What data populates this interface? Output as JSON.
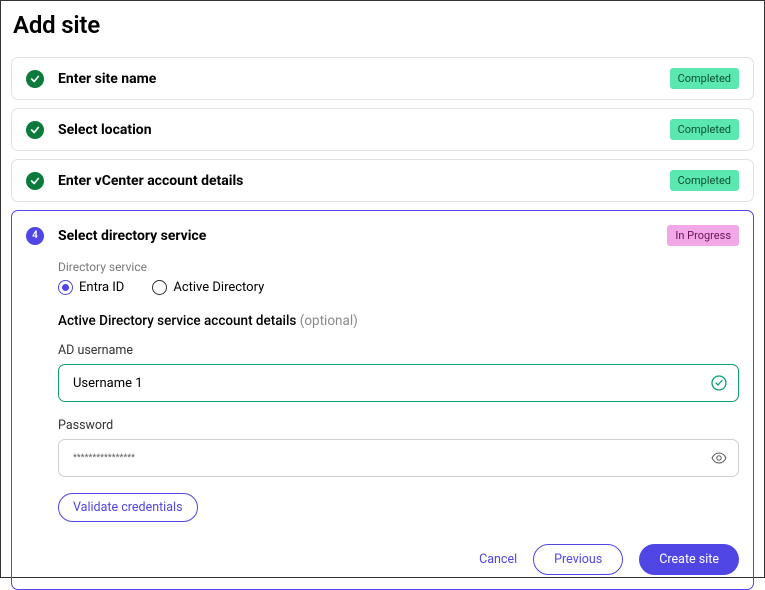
{
  "page": {
    "title": "Add site"
  },
  "steps": [
    {
      "title": "Enter site name",
      "status": "Completed"
    },
    {
      "title": "Select location",
      "status": "Completed"
    },
    {
      "title": "Enter vCenter account details",
      "status": "Completed"
    }
  ],
  "current": {
    "number": "4",
    "title": "Select directory service",
    "status": "In Progress"
  },
  "directory": {
    "label": "Directory service",
    "option1": "Entra ID",
    "option2": "Active Directory",
    "selected": "Entra ID"
  },
  "ad_section": {
    "title": "Active Directory service account details ",
    "optional": "(optional)",
    "username_label": "AD username",
    "username_value": "Username 1",
    "password_label": "Password",
    "password_masked": "****************"
  },
  "buttons": {
    "validate": "Validate credentials",
    "cancel": "Cancel",
    "previous": "Previous",
    "create": "Create site"
  }
}
